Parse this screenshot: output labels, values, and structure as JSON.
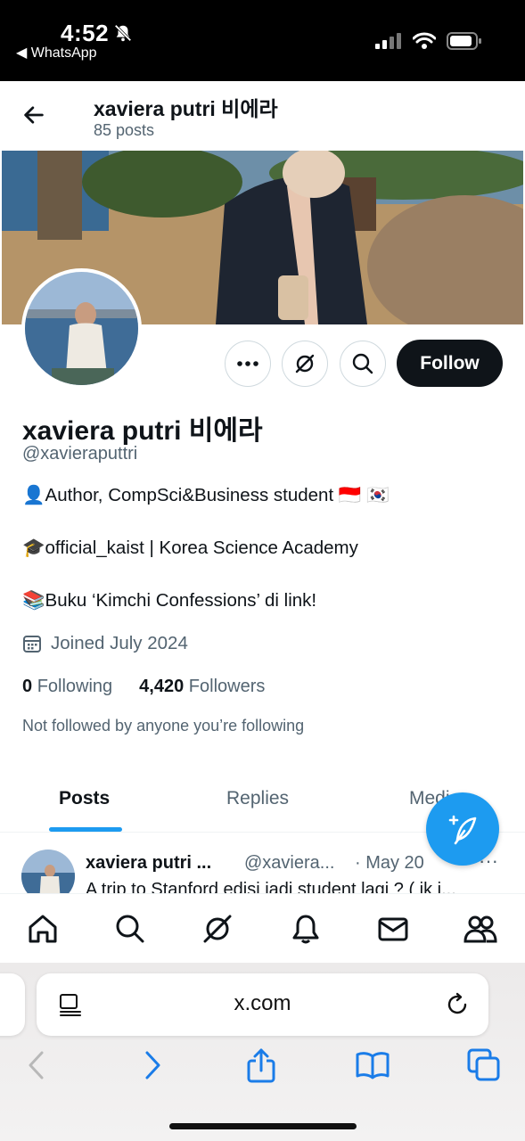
{
  "status_bar": {
    "time": "4:52",
    "back_app": "◀ WhatsApp"
  },
  "header": {
    "name": "xaviera putri 비에라",
    "posts": "85 posts"
  },
  "profile": {
    "name": "xaviera putri 비에라",
    "handle": "@xavieraputtri",
    "follow_label": "Follow",
    "bio": [
      {
        "icon": "👤",
        "text": " Author, CompSci&Business student 🇮🇩 🇰🇷"
      },
      {
        "icon": "🎓",
        "text": "official_kaist | Korea Science Academy"
      },
      {
        "icon": "📚",
        "text": " Buku ‘Kimchi Confessions’ di link!"
      }
    ],
    "joined": "Joined July 2024",
    "following_count": "0",
    "following_label": "Following",
    "followers_count": "4,420",
    "followers_label": "Followers",
    "not_followed": "Not followed by anyone you’re following"
  },
  "tabs": [
    {
      "label": "Posts",
      "active": true
    },
    {
      "label": "Replies",
      "active": false
    },
    {
      "label": "Media",
      "active": false
    }
  ],
  "tweet": {
    "name": "xaviera putri ...",
    "handle": "@xaviera...",
    "date": "· May 20",
    "more": "···",
    "text": "A trip to Stanford edisi jadi student lagi ? ( ik i..."
  },
  "safari": {
    "url": "x.com"
  },
  "colors": {
    "accent": "#1d9bf0",
    "text": "#0f1419",
    "secondary": "#536471"
  }
}
